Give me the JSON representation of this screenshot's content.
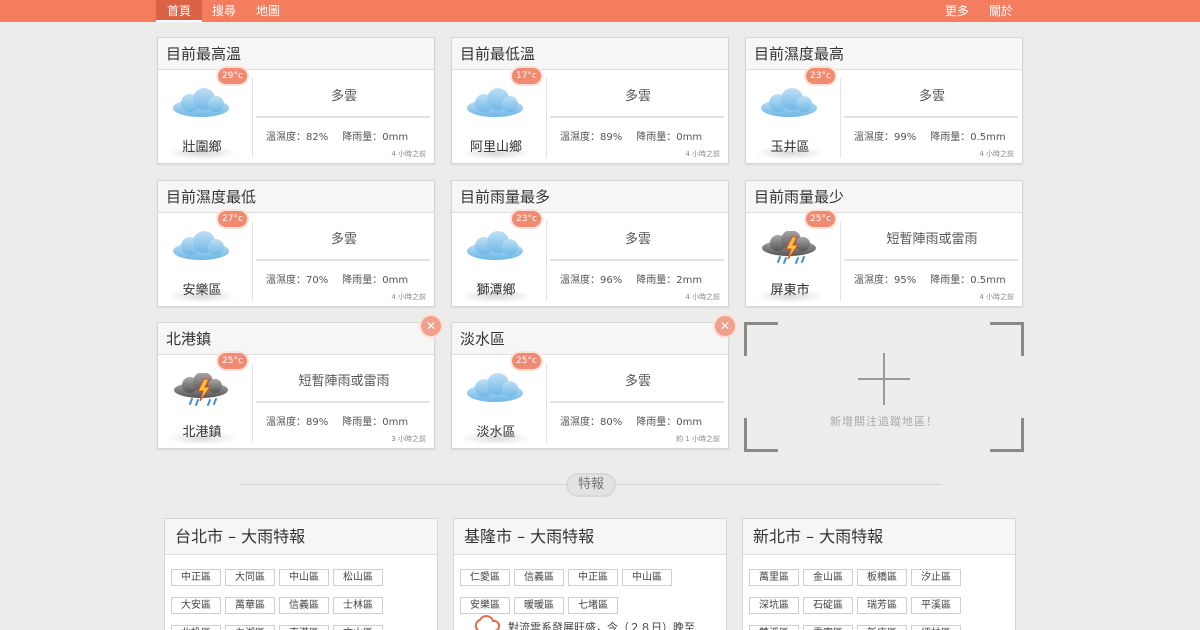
{
  "nav": {
    "home": "首頁",
    "search": "搜尋",
    "map": "地圖",
    "more": "更多",
    "about": "關於"
  },
  "cards": [
    {
      "title": "目前最高溫",
      "temp": "29°c",
      "icon": "cloud-icon",
      "location": "壯圍鄉",
      "condition": "多雲",
      "humidity": "溫濕度：82%",
      "rain": "降雨量：0mm",
      "ago": "4 小時之前"
    },
    {
      "title": "目前最低溫",
      "temp": "17°c",
      "icon": "cloud-icon",
      "location": "阿里山鄉",
      "condition": "多雲",
      "humidity": "溫濕度：89%",
      "rain": "降雨量：0mm",
      "ago": "4 小時之前"
    },
    {
      "title": "目前濕度最高",
      "temp": "23°c",
      "icon": "cloud-icon",
      "location": "玉井區",
      "condition": "多雲",
      "humidity": "溫濕度：99%",
      "rain": "降雨量：0.5mm",
      "ago": "4 小時之前"
    },
    {
      "title": "目前濕度最低",
      "temp": "27°c",
      "icon": "cloud-icon",
      "location": "安樂區",
      "condition": "多雲",
      "humidity": "溫濕度：70%",
      "rain": "降雨量：0mm",
      "ago": "4 小時之前"
    },
    {
      "title": "目前雨量最多",
      "temp": "23°c",
      "icon": "cloud-icon",
      "location": "獅潭鄉",
      "condition": "多雲",
      "humidity": "溫濕度：96%",
      "rain": "降雨量：2mm",
      "ago": "4 小時之前"
    },
    {
      "title": "目前雨量最少",
      "temp": "25°c",
      "icon": "thunderstorm-icon",
      "location": "屏東市",
      "condition": "短暫陣雨或雷雨",
      "humidity": "溫濕度：95%",
      "rain": "降雨量：0.5mm",
      "ago": "4 小時之前"
    },
    {
      "title": "北港鎮",
      "temp": "25°c",
      "icon": "thunderstorm-icon",
      "location": "北港鎮",
      "condition": "短暫陣雨或雷雨",
      "humidity": "溫濕度：89%",
      "rain": "降雨量：0mm",
      "ago": "3 小時之前",
      "closable": true
    },
    {
      "title": "淡水區",
      "temp": "25°c",
      "icon": "cloud-icon",
      "location": "淡水區",
      "condition": "多雲",
      "humidity": "溫濕度：80%",
      "rain": "降雨量：0mm",
      "ago": "約 1 小時之前",
      "closable": true
    }
  ],
  "add_card": {
    "label": "新增關注追蹤地區！"
  },
  "section": {
    "label": "特報"
  },
  "alerts": [
    {
      "title": "台北市 – 大雨特報",
      "districts": [
        "中正區",
        "大同區",
        "中山區",
        "松山區",
        "大安區",
        "萬華區",
        "信義區",
        "士林區",
        "北投區",
        "內湖區",
        "南港區",
        "文山區"
      ]
    },
    {
      "title": "基隆市 – 大雨特報",
      "districts": [
        "仁愛區",
        "信義區",
        "中正區",
        "中山區",
        "安樂區",
        "暖暖區",
        "七堵區"
      ],
      "text": "對流雲系發展旺盛，今（２８日）晚至"
    },
    {
      "title": "新北市 – 大雨特報",
      "districts": [
        "萬里區",
        "金山區",
        "板橋區",
        "汐止區",
        "深坑區",
        "石碇區",
        "瑞芳區",
        "平溪區",
        "雙溪區",
        "貢寮區",
        "新店區",
        "坪林區"
      ]
    }
  ],
  "colors": {
    "accent": "#f47d60",
    "badge": "#f08a70",
    "background": "#ececec"
  }
}
